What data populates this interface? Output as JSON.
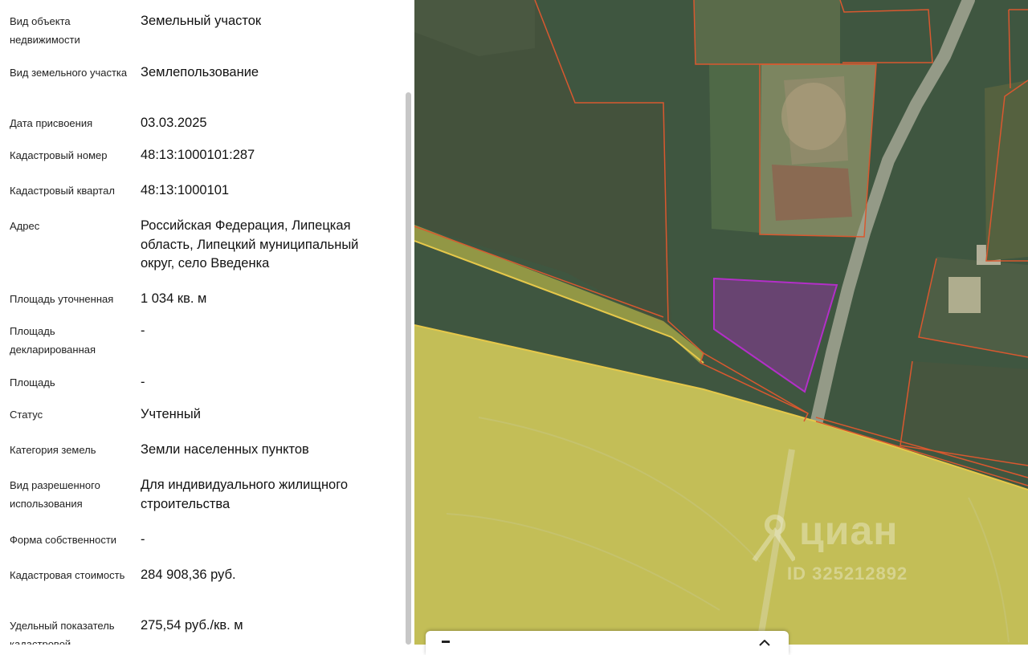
{
  "property_details": {
    "rows": [
      {
        "label": "Вид объекта недвижимости",
        "value": "Земельный участок"
      },
      {
        "label": "Вид земельного участка",
        "value": "Землепользование"
      },
      {
        "label": "Дата присвоения",
        "value": "03.03.2025"
      },
      {
        "label": "Кадастровый номер",
        "value": "48:13:1000101:287"
      },
      {
        "label": "Кадастровый квартал",
        "value": "48:13:1000101"
      },
      {
        "label": "Адрес",
        "value": "Российская Федерация, Липецкая область, Липецкий муниципальный округ, село Введенка"
      },
      {
        "label": "Площадь уточненная",
        "value": "1 034 кв. м"
      },
      {
        "label": "Площадь декларированная",
        "value": "-"
      },
      {
        "label": "Площадь",
        "value": "-"
      },
      {
        "label": "Статус",
        "value": "Учтенный"
      },
      {
        "label": "Категория земель",
        "value": "Земли населенных пунктов"
      },
      {
        "label": "Вид разрешенного использования",
        "value": "Для индивидуального жилищного строительства"
      },
      {
        "label": "Форма собственности",
        "value": "-"
      },
      {
        "label": "Кадастровая стоимость",
        "value": "284 908,36 руб."
      },
      {
        "label": "Удельный показатель кадастровой",
        "value": "275,54 руб./кв. м"
      }
    ]
  },
  "map": {
    "watermark_logo": "циан",
    "watermark_id": "ID 325212892",
    "colors": {
      "selected_parcel": "#9b2fae",
      "parcel_border": "#d9582f",
      "zone_border": "#e6c84a",
      "field": "#b6b55a",
      "vegetation": "#3f5640"
    }
  }
}
